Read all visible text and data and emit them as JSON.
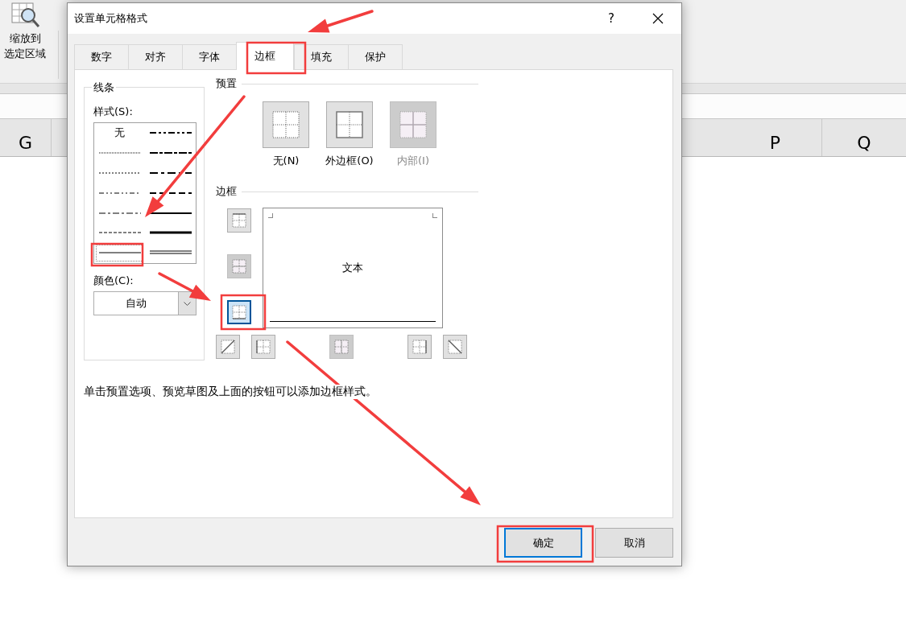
{
  "ribbon": {
    "zoom_button": {
      "lines": [
        "缩放到",
        "选定区域"
      ]
    }
  },
  "column_headers_left": [
    "G"
  ],
  "column_headers_right": [
    "P",
    "Q"
  ],
  "dialog": {
    "title": "设置单元格格式",
    "help": "?",
    "tabs": [
      {
        "label": "数字",
        "selected": false
      },
      {
        "label": "对齐",
        "selected": false
      },
      {
        "label": "字体",
        "selected": false
      },
      {
        "label": "边框",
        "selected": true
      },
      {
        "label": "填充",
        "selected": false
      },
      {
        "label": "保护",
        "selected": false
      }
    ],
    "line": {
      "title": "线条",
      "style_label": "样式(S):",
      "styles": [
        {
          "kind": "none",
          "text": "无",
          "selected": false
        },
        {
          "kind": "hair",
          "selected": false
        },
        {
          "kind": "dotted",
          "selected": false
        },
        {
          "kind": "dashdotdot",
          "selected": false
        },
        {
          "kind": "dashdot",
          "selected": false
        },
        {
          "kind": "dashed",
          "selected": false
        },
        {
          "kind": "thin",
          "selected": true
        },
        {
          "kind": "mediumdashdotdot",
          "selected": false
        },
        {
          "kind": "slantdashdot",
          "selected": false
        },
        {
          "kind": "mediumdashdot",
          "selected": false
        },
        {
          "kind": "mediumdashed",
          "selected": false
        },
        {
          "kind": "medium",
          "selected": false
        },
        {
          "kind": "thick",
          "selected": false
        },
        {
          "kind": "double",
          "selected": false
        }
      ],
      "color_label": "颜色(C):",
      "color_value": "自动"
    },
    "presets": {
      "title": "预置",
      "items": [
        {
          "kind": "none",
          "label": "无(N)",
          "disabled": false
        },
        {
          "kind": "outline",
          "label": "外边框(O)",
          "disabled": false
        },
        {
          "kind": "inside",
          "label": "内部(I)",
          "disabled": true
        }
      ]
    },
    "border": {
      "title": "边框",
      "preview_text": "文本",
      "side_buttons": [
        {
          "kind": "top",
          "selected": false,
          "disabled": false
        },
        {
          "kind": "inside-horizontal",
          "selected": false,
          "disabled": true
        },
        {
          "kind": "bottom",
          "selected": true,
          "disabled": false
        }
      ],
      "bottom_buttons": [
        {
          "kind": "diagonal-up",
          "selected": false,
          "disabled": false
        },
        {
          "kind": "left",
          "selected": false,
          "disabled": false
        },
        {
          "kind": "inside-vertical",
          "selected": false,
          "disabled": true
        },
        {
          "kind": "right",
          "selected": false,
          "disabled": false
        },
        {
          "kind": "diagonal-down",
          "selected": false,
          "disabled": false
        }
      ]
    },
    "hint": "单击预置选项、预览草图及上面的按钮可以添加边框样式。",
    "buttons": [
      {
        "label": "确定",
        "default": true
      },
      {
        "label": "取消",
        "default": false
      }
    ]
  }
}
